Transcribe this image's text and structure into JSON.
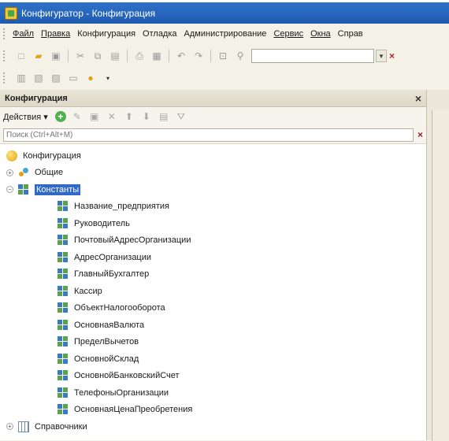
{
  "window": {
    "title": "Конфигуратор - Конфигурация"
  },
  "menu": [
    "Файл",
    "Правка",
    "Конфигурация",
    "Отладка",
    "Администрирование",
    "Сервис",
    "Окна",
    "Справ"
  ],
  "panel": {
    "title": "Конфигурация",
    "actions_label": "Действия",
    "search_placeholder": "Поиск (Ctrl+Alt+M)"
  },
  "tree": {
    "root": "Конфигурация",
    "common": "Общие",
    "constants": "Константы",
    "constant_items": [
      "Название_предприятия",
      "Руководитель",
      "ПочтовыйАдресОрганизации",
      "АдресОрганизации",
      "ГлавныйБухгалтер",
      "Кассир",
      "ОбъектНалогооборота",
      "ОсновнаяВалюта",
      "ПределВычетов",
      "ОсновнойСклад",
      "ОсновнойБанковскийСчет",
      "ТелефоныОрганизации",
      "ОсновнаяЦенаПреобретения"
    ],
    "catalogs": "Справочники"
  },
  "colors": {
    "titlebar": "#1f5bb0",
    "selection": "#3169c6"
  }
}
